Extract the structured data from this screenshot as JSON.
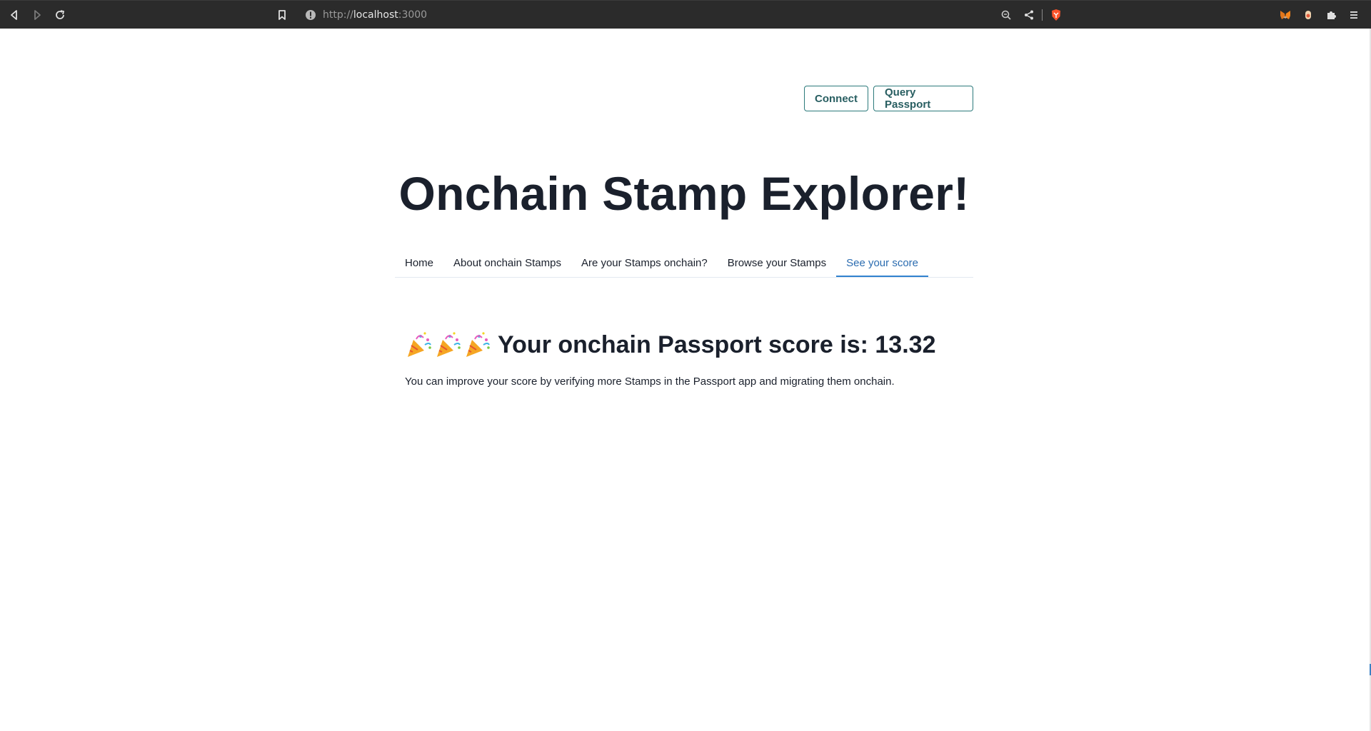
{
  "browser": {
    "url_prefix": "http://",
    "url_host": "localhost",
    "url_port": ":3000"
  },
  "header": {
    "connect_label": "Connect",
    "query_label": "Query Passport"
  },
  "page": {
    "title": "Onchain Stamp Explorer!"
  },
  "tabs": [
    {
      "label": "Home"
    },
    {
      "label": "About onchain Stamps"
    },
    {
      "label": "Are your Stamps onchain?"
    },
    {
      "label": "Browse your Stamps"
    },
    {
      "label": "See your score"
    }
  ],
  "active_tab": "See your score",
  "score": {
    "heading_text": "Your onchain Passport score is: 13.32",
    "note": "You can improve your score by verifying more Stamps in the Passport app and migrating them onchain."
  },
  "colors": {
    "accent": "#3182ce",
    "button_border": "#2c7a7b",
    "toolbar_bg": "#2b2b2b"
  }
}
